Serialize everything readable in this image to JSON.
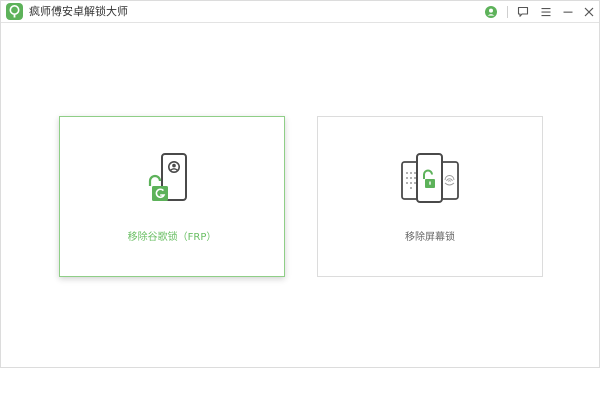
{
  "app": {
    "title": "疯师傅安卓解锁大师"
  },
  "titlebar": {
    "icons": [
      "app-logo-icon",
      "user-icon",
      "feedback-icon",
      "menu-icon",
      "minimize-icon",
      "close-icon"
    ]
  },
  "cards": [
    {
      "label": "移除谷歌锁（FRP）",
      "icon": "phone-google-lock-icon",
      "selected": true
    },
    {
      "label": "移除屏幕锁",
      "icon": "phones-unlock-icon",
      "selected": false
    }
  ],
  "colors": {
    "accent": "#5db25a",
    "accent_light": "#8fce87",
    "text_dark": "#333333",
    "text_gray": "#666666",
    "icon_dark": "#4a4a4a"
  }
}
